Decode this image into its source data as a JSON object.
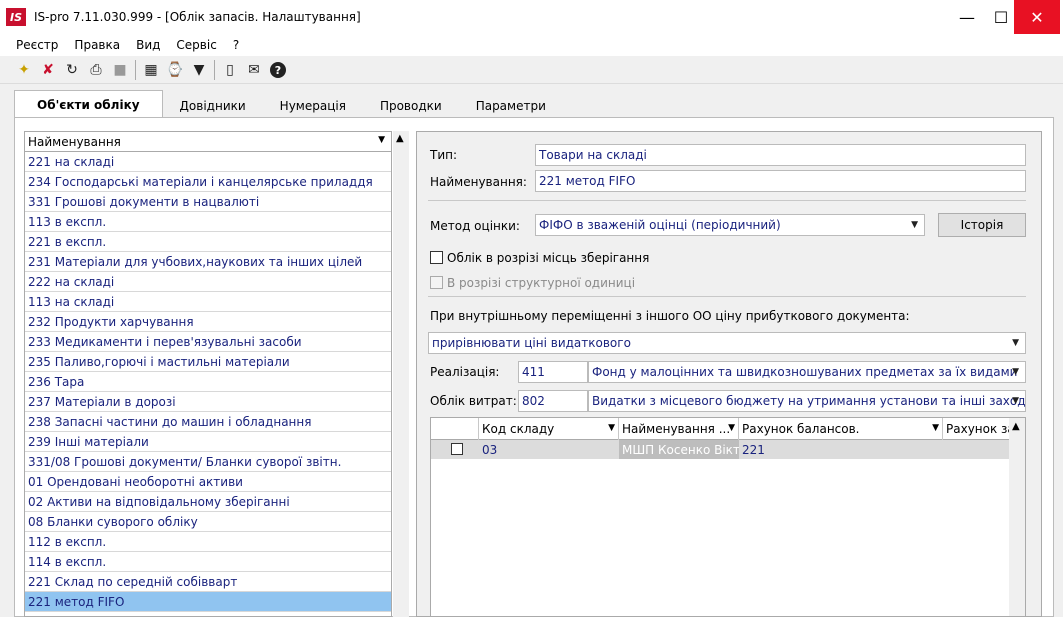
{
  "window": {
    "logo_text": "IS",
    "title": "IS-pro 7.11.030.999 - [Облік запасів. Налаштування]"
  },
  "menu": [
    "Реєстр",
    "Правка",
    "Вид",
    "Сервіс",
    "?"
  ],
  "toolbar_icons": [
    "new-doc-icon",
    "delete-doc-icon",
    "refresh-icon",
    "print-icon",
    "stop-icon",
    "table-icon",
    "history-icon",
    "filter-icon",
    "page-icon",
    "mail-icon",
    "help-icon"
  ],
  "tabs": [
    "Об'єкти обліку",
    "Довідники",
    "Нумерація",
    "Проводки",
    "Параметри"
  ],
  "list": {
    "header": "Найменування",
    "items": [
      "221 на складі",
      "234 Господарські матеріали і канцелярське приладдя",
      "331 Грошові документи в нацвалюті",
      "113 в експл.",
      "221 в експл.",
      "231 Матеріали для учбових,наукових та інших цілей",
      "222 на складі",
      "113 на складі",
      "232  Продукти харчування",
      "233 Медикаменти і перев'язувальні засоби",
      "235 Паливо,горючі і мастильні матеріали",
      "236 Тара",
      "237 Матеріали в дорозі",
      "238 Запасні частини до машин і обладнання",
      "239 Інші матеріали",
      "331/08  Грошові документи/ Бланки суворої звітн.",
      "01 Орендовані необоротні активи",
      "02 Активи на відповідальному зберіганні",
      "08 Бланки суворого обліку",
      "112 в експл.",
      "114 в експл.",
      "221 Склад по середній собівварт",
      "221 метод FIFO"
    ],
    "selected_index": 22
  },
  "form": {
    "type_label": "Тип:",
    "type_value": "Товари на складі",
    "name_label": "Найменування:",
    "name_value": "221 метод FIFO",
    "method_label": "Метод оцінки:",
    "method_value": "ФІФО в зваженій оцінці (періодичний)",
    "history_button": "Історія",
    "storage_checkbox_label": "Облік в розрізі місць зберігання",
    "structural_checkbox_label": "В розрізі структурної одиниці",
    "transfer_label": "При внутрішньому переміщенні з іншого ОО ціну прибуткового документа:",
    "transfer_value": "прирівнювати ціні видаткового",
    "realization_label": "Реалізація:",
    "realization_code": "411",
    "realization_name": "Фонд у малоцінних та швидкозношуваних предметах за їх видами",
    "expense_label": "Облік витрат:",
    "expense_code": "802",
    "expense_name": "Видатки з місцевого бюджету на утримання установи та інші заходи"
  },
  "grid": {
    "columns": [
      "Код складу",
      "Найменування ...",
      "Рахунок балансов.",
      "Рахунок за"
    ],
    "rows": [
      {
        "code": "03",
        "name": "МШП Косенко Вікт...",
        "account": "221",
        "account2": ""
      }
    ]
  }
}
